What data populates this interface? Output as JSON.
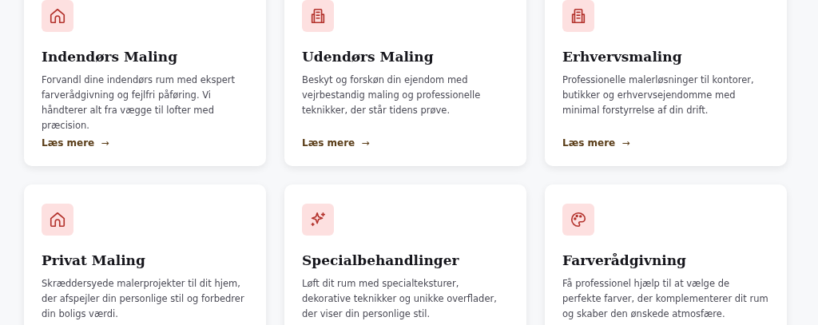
{
  "services": [
    {
      "title": "Indendørs Maling",
      "description": "Forvandl dine indendørs rum med ekspert farverådgivning og fejlfri påføring. Vi håndterer alt fra vægge til lofter med præcision.",
      "link": "Læs mere",
      "link_arrow": "→"
    },
    {
      "title": "Udendørs Maling",
      "description": "Beskyt og forskøn din ejendom med vejrbestandig maling og professionelle teknikker, der står tidens prøve.",
      "link": "Læs mere",
      "link_arrow": "→"
    },
    {
      "title": "Erhvervsmaling",
      "description": "Professionelle malerløsninger til kontorer, butikker og erhvervsejendomme med minimal forstyrrelse af din drift.",
      "link": "Læs mere",
      "link_arrow": "→"
    },
    {
      "title": "Privat Maling",
      "description": "Skræddersyede malerprojekter til dit hjem, der afspejler din personlige stil og forbedrer din boligs værdi."
    },
    {
      "title": "Specialbehandlinger",
      "description": "Løft dit rum med specialteksturer, dekorative teknikker og unikke overflader, der viser din personlige stil."
    },
    {
      "title": "Farverådgivning",
      "description": "Få professionel hjælp til at vælge de perfekte farver, der komplementerer dit rum og skaber den ønskede atmosfære."
    }
  ]
}
